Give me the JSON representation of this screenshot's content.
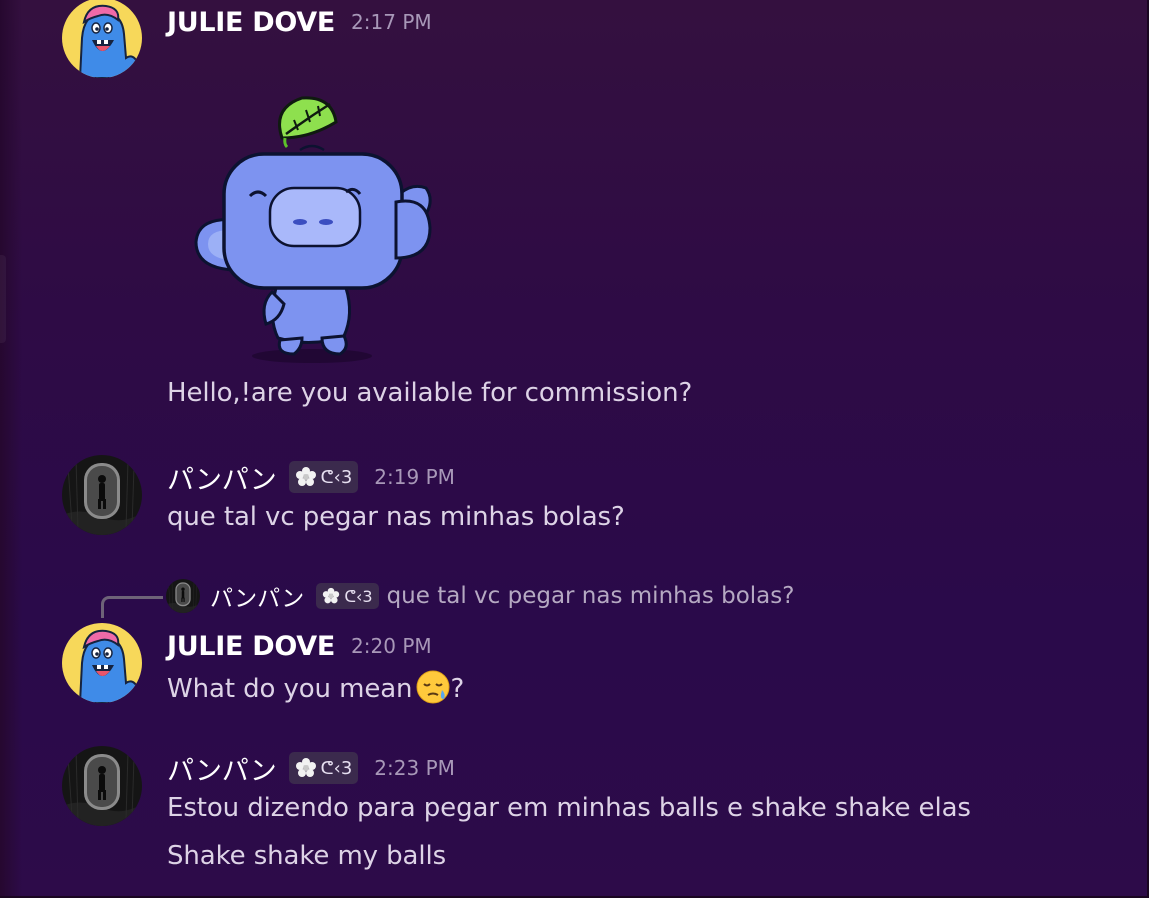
{
  "messages": [
    {
      "author": "JULIE DOVE",
      "timestamp": "2:17 PM",
      "sticker": "wumpus-waving-sticker",
      "lines": [
        "Hello,!are you available for commission?"
      ]
    },
    {
      "author": "パンパン",
      "tag": "ᕦ‹3",
      "timestamp": "2:19 PM",
      "lines": [
        "que tal vc pegar nas minhas bolas?"
      ]
    },
    {
      "author": "JULIE DOVE",
      "timestamp": "2:20 PM",
      "reply_to": {
        "author": "パンパン",
        "tag": "ᕦ‹3",
        "text": "que tal vc pegar nas minhas bolas?"
      },
      "lines": [
        "What do you mean",
        "?"
      ],
      "emoji": "sleepy-face-emoji"
    },
    {
      "author": "パンパン",
      "tag": "ᕦ‹3",
      "timestamp": "2:23 PM",
      "lines": [
        "Estou dizendo para pegar em minhas balls e shake shake elas",
        "Shake shake my balls"
      ]
    }
  ],
  "icons": {
    "julie_avatar": "cartoon-monster-avatar",
    "panpan_avatar": "dark-figure-avatar",
    "tag_icon": "flower-icon"
  },
  "colors": {
    "background": "#2e0b45",
    "username": "#ffffff",
    "message_text": "#ddd3e6",
    "timestamp": "#a898b8",
    "tag_background": "#3b2a4d"
  }
}
